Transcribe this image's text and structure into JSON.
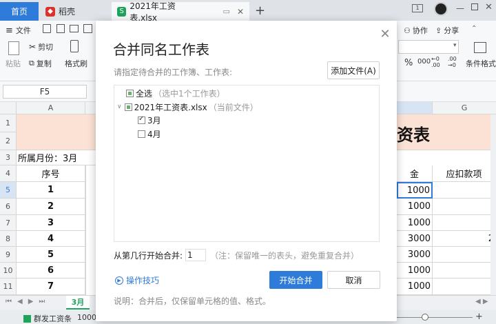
{
  "tabs": {
    "home": "首页",
    "daoke": "稻壳",
    "doc": "2021年工资表.xlsx"
  },
  "toolbar": {
    "file": "文件",
    "paste": "粘贴",
    "cut": "剪切",
    "copy": "复制",
    "format_painter": "格式刷",
    "collab": "协作",
    "share": "分享",
    "cond_format": "条件格式",
    "percent": "%",
    "thousands": "000",
    "dec_inc": "←0 .00",
    "dec_dec": ".00 →0"
  },
  "formula": {
    "cell_ref": "F5"
  },
  "sheet": {
    "col_a": "A",
    "col_g": "G",
    "title_fragment": "资表",
    "month_label": "所属月份：3月",
    "header_seq": "序号",
    "header_amount_fragment": "金",
    "header_deduct": "应扣款项",
    "rows": [
      "1",
      "2",
      "3",
      "4",
      "5",
      "6",
      "7",
      "8",
      "9",
      "10",
      "11"
    ],
    "seq": [
      "1",
      "2",
      "3",
      "4",
      "5",
      "6",
      "7"
    ],
    "amounts": [
      "1000",
      "1000",
      "1000",
      "3000",
      "3000",
      "1000",
      "1000"
    ],
    "g8_fragment": "2"
  },
  "sheet_tabs": {
    "active": "3月"
  },
  "status": {
    "app_name": "群发工资条",
    "value": "1000"
  },
  "dialog": {
    "title": "合并同名工作表",
    "hint": "请指定待合并的工作簿、工作表:",
    "add_file": "添加文件(A)",
    "select_all": "全选",
    "select_all_note": "（选中1个工作表）",
    "file_name": "2021年工资表.xlsx",
    "file_note": "（当前文件）",
    "sheet_march": "3月",
    "sheet_april": "4月",
    "start_row_label": "从第几行开始合并:",
    "start_row_value": "1",
    "start_row_note": "（注：保留唯一的表头，避免重复合并）",
    "tips": "操作技巧",
    "start_button": "开始合并",
    "cancel_button": "取消",
    "note": "说明：合并后，仅保留单元格的值、格式。"
  }
}
